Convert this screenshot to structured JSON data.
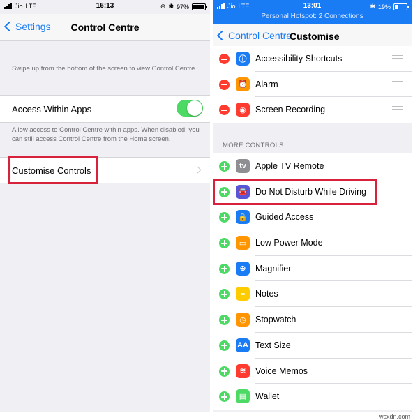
{
  "left": {
    "status": {
      "carrier": "Jio",
      "network": "LTE",
      "time": "16:13",
      "battery": "97%"
    },
    "nav": {
      "back_label": "Settings",
      "title": "Control Centre"
    },
    "swipe_note": "Swipe up from the bottom of the screen to view Control Centre.",
    "access_within_apps": {
      "label": "Access Within Apps",
      "on": true
    },
    "access_note": "Allow access to Control Centre within apps. When disabled, you can still access Control Centre from the Home screen.",
    "customise_label": "Customise Controls"
  },
  "right": {
    "status": {
      "carrier": "Jio",
      "network": "LTE",
      "time": "13:01",
      "battery": "19%",
      "hotspot": "Personal Hotspot: 2 Connections"
    },
    "nav": {
      "back_label": "Control Centre",
      "title": "Customise"
    },
    "included": [
      {
        "label": "Accessibility Shortcuts",
        "icon": "accessibility-icon",
        "color": "#1a7cf5"
      },
      {
        "label": "Alarm",
        "icon": "alarm-clock-icon",
        "color": "#ff9500"
      },
      {
        "label": "Screen Recording",
        "icon": "record-icon",
        "color": "#ff3b30"
      }
    ],
    "more_header": "MORE CONTROLS",
    "more": [
      {
        "label": "Apple TV Remote",
        "icon": "tv-remote-icon",
        "color": "#8e8e93"
      },
      {
        "label": "Do Not Disturb While Driving",
        "icon": "car-icon",
        "color": "#5856d6"
      },
      {
        "label": "Guided Access",
        "icon": "lock-icon",
        "color": "#1a7cf5"
      },
      {
        "label": "Low Power Mode",
        "icon": "battery-icon",
        "color": "#ff9500"
      },
      {
        "label": "Magnifier",
        "icon": "magnifier-icon",
        "color": "#1a7cf5"
      },
      {
        "label": "Notes",
        "icon": "notes-icon",
        "color": "#ffcc00"
      },
      {
        "label": "Stopwatch",
        "icon": "stopwatch-icon",
        "color": "#ff9500"
      },
      {
        "label": "Text Size",
        "icon": "text-size-icon",
        "color": "#1a7cf5"
      },
      {
        "label": "Voice Memos",
        "icon": "voice-memo-icon",
        "color": "#ff3b30"
      },
      {
        "label": "Wallet",
        "icon": "wallet-icon",
        "color": "#4cd964"
      }
    ]
  },
  "watermark": "wsxdn.com",
  "highlight_color": "#d8213a"
}
